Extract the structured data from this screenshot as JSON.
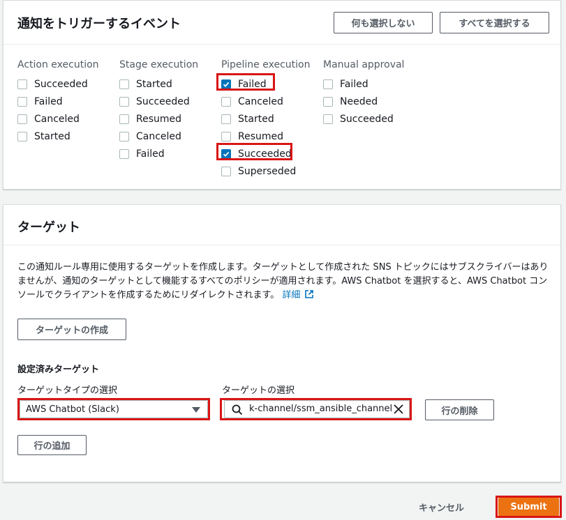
{
  "events_panel": {
    "title": "通知をトリガーするイベント",
    "select_none_label": "何も選択しない",
    "select_all_label": "すべてを選択する",
    "columns": [
      {
        "title": "Action execution",
        "items": [
          {
            "label": "Succeeded",
            "checked": false
          },
          {
            "label": "Failed",
            "checked": false
          },
          {
            "label": "Canceled",
            "checked": false
          },
          {
            "label": "Started",
            "checked": false
          }
        ]
      },
      {
        "title": "Stage execution",
        "items": [
          {
            "label": "Started",
            "checked": false
          },
          {
            "label": "Succeeded",
            "checked": false
          },
          {
            "label": "Resumed",
            "checked": false
          },
          {
            "label": "Canceled",
            "checked": false
          },
          {
            "label": "Failed",
            "checked": false
          }
        ]
      },
      {
        "title": "Pipeline execution",
        "items": [
          {
            "label": "Failed",
            "checked": true
          },
          {
            "label": "Canceled",
            "checked": false
          },
          {
            "label": "Started",
            "checked": false
          },
          {
            "label": "Resumed",
            "checked": false
          },
          {
            "label": "Succeeded",
            "checked": true
          },
          {
            "label": "Superseded",
            "checked": false
          }
        ]
      },
      {
        "title": "Manual approval",
        "items": [
          {
            "label": "Failed",
            "checked": false
          },
          {
            "label": "Needed",
            "checked": false
          },
          {
            "label": "Succeeded",
            "checked": false
          }
        ]
      }
    ]
  },
  "target_panel": {
    "title": "ターゲット",
    "description": "この通知ルール専用に使用するターゲットを作成します。ターゲットとして作成された SNS トピックにはサブスクライバーはありませんが、通知のターゲットとして機能するすべてのポリシーが適用されます。AWS Chatbot を選択すると、AWS Chatbot コンソールでクライアントを作成するためにリダイレクトされます。",
    "details_link": "詳細",
    "create_target_label": "ターゲットの作成",
    "configured_targets_label": "設定済みターゲット",
    "target_type_label": "ターゲットタイプの選択",
    "target_type_value": "AWS Chatbot (Slack)",
    "target_select_label": "ターゲットの選択",
    "target_select_value": "k-channel/ssm_ansible_channel",
    "remove_row_label": "行の削除",
    "add_row_label": "行の追加"
  },
  "footer": {
    "cancel_label": "キャンセル",
    "submit_label": "Submit"
  },
  "colors": {
    "highlight": "#d91515",
    "primary": "#ec7211",
    "checkbox_checked": "#0073bb",
    "link": "#0073bb"
  }
}
